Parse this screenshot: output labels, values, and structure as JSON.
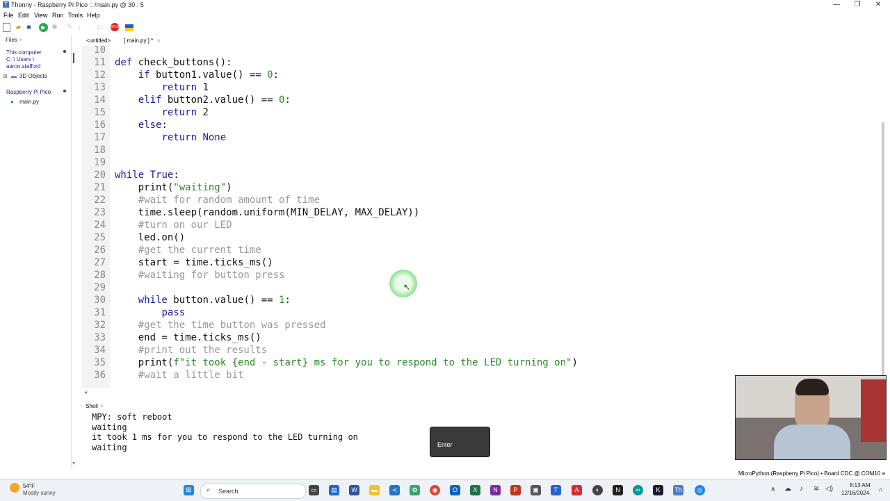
{
  "window": {
    "title": "Thonny  -  Raspberry Pi Pico :: /main.py  @  30 : 5",
    "minimize": "—",
    "maximize": "❐",
    "close": "✕"
  },
  "menu": [
    "File",
    "Edit",
    "View",
    "Run",
    "Tools",
    "Help"
  ],
  "files": {
    "tab": "Files",
    "this_computer": "This computer",
    "path1": "C: \\ Users \\",
    "path2": "aaron.stafford",
    "objects": "3D Objects",
    "pico": "Raspberry Pi Pico",
    "mainpy": "main.py"
  },
  "editor_tabs": {
    "untitled": "<untitled>",
    "main": "[ main.py ] *",
    "close": "×"
  },
  "code": [
    {
      "n": "10",
      "text": ""
    },
    {
      "n": "11",
      "text": "def check_buttons():"
    },
    {
      "n": "12",
      "text": "    if button1.value() == 0:"
    },
    {
      "n": "13",
      "text": "        return 1"
    },
    {
      "n": "14",
      "text": "    elif button2.value() == 0:"
    },
    {
      "n": "15",
      "text": "        return 2"
    },
    {
      "n": "16",
      "text": "    else:"
    },
    {
      "n": "17",
      "text": "        return None"
    },
    {
      "n": "18",
      "text": ""
    },
    {
      "n": "19",
      "text": ""
    },
    {
      "n": "20",
      "text": "while True:"
    },
    {
      "n": "21",
      "text": "    print(\"waiting\")"
    },
    {
      "n": "22",
      "text": "    #wait for random amount of time",
      "comment": true
    },
    {
      "n": "23",
      "text": "    time.sleep(random.uniform(MIN_DELAY, MAX_DELAY))"
    },
    {
      "n": "24",
      "text": "    #turn on our LED",
      "comment": true
    },
    {
      "n": "25",
      "text": "    led.on()"
    },
    {
      "n": "26",
      "text": "    #get the current time",
      "comment": true
    },
    {
      "n": "27",
      "text": "    start = time.ticks_ms()"
    },
    {
      "n": "28",
      "text": "    #waiting for button press",
      "comment": true
    },
    {
      "n": "29",
      "text": ""
    },
    {
      "n": "30",
      "text": "    while button.value() == 1:"
    },
    {
      "n": "31",
      "text": "        pass"
    },
    {
      "n": "32",
      "text": "    #get the time button was pressed",
      "comment": true
    },
    {
      "n": "33",
      "text": "    end = time.ticks_ms()"
    },
    {
      "n": "34",
      "text": "    #print out the results",
      "comment": true
    },
    {
      "n": "35",
      "text": "    print(f\"it took {end - start} ms for you to respond to the LED turning on\")"
    },
    {
      "n": "36",
      "text": "    #wait a little bit",
      "comment": true
    }
  ],
  "shell": {
    "tab": "Shell",
    "lines": [
      "MPY: soft reboot",
      "waiting",
      "it took 1 ms for you to respond to the LED turning on",
      "waiting"
    ]
  },
  "overlay_key": "Enter",
  "status": "MicroPython (Raspberry Pi Pico)  •  Board CDC @ COM10  ≡",
  "taskbar": {
    "weather_temp": "54°F",
    "weather_desc": "Mostly sunny",
    "search_placeholder": "Search",
    "time": "8:13 AM",
    "date": "12/16/2024"
  }
}
